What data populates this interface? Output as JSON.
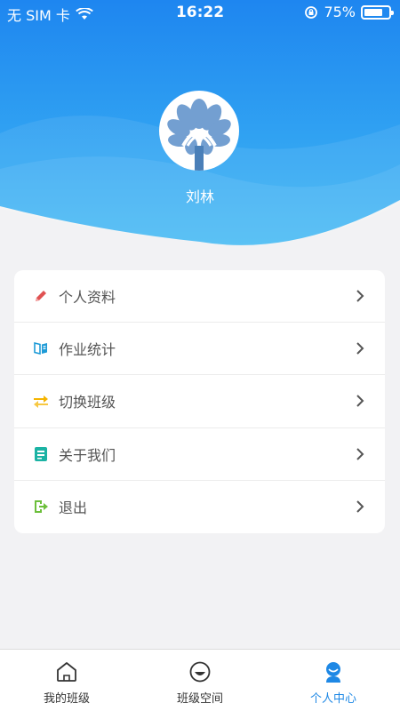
{
  "status": {
    "carrier": "无 SIM 卡",
    "time": "16:22",
    "battery_percent": "75%",
    "battery_level": 0.75
  },
  "profile": {
    "name": "刘林"
  },
  "menu": [
    {
      "label": "个人资料",
      "icon": "pencil-icon",
      "color": "#e05252"
    },
    {
      "label": "作业统计",
      "icon": "book-icon",
      "color": "#1e9bd7"
    },
    {
      "label": "切换班级",
      "icon": "swap-icon",
      "color": "#f5b400"
    },
    {
      "label": "关于我们",
      "icon": "info-card-icon",
      "color": "#1bb3a4"
    },
    {
      "label": "退出",
      "icon": "logout-icon",
      "color": "#6cbf3b"
    }
  ],
  "tabs": [
    {
      "label": "我的班级",
      "icon": "home-icon",
      "active": false
    },
    {
      "label": "班级空间",
      "icon": "smile-icon",
      "active": false
    },
    {
      "label": "个人中心",
      "icon": "user-icon",
      "active": true
    }
  ],
  "colors": {
    "header_top": "#2d8ff0",
    "header_bottom": "#39b6f2",
    "accent": "#1e88e5"
  }
}
